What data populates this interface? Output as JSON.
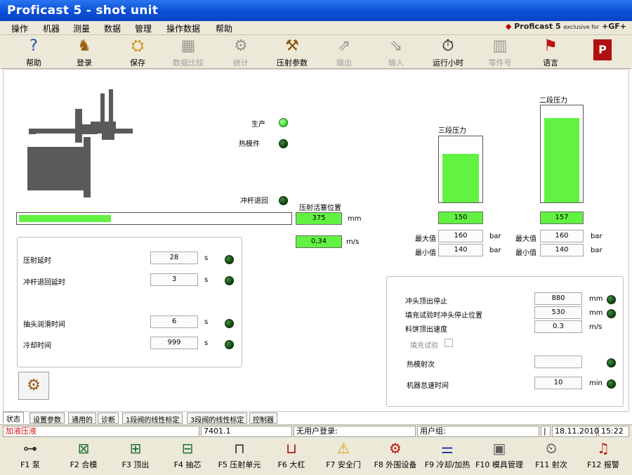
{
  "window": {
    "title": "Proficast 5 - shot unit"
  },
  "menu": {
    "items": [
      "操作",
      "机器",
      "测量",
      "数据",
      "管理",
      "操作数据",
      "帮助"
    ],
    "brand": "Proficast 5",
    "brand_excl": "exclusive for",
    "brand_gf": "+GF+"
  },
  "toolbar": {
    "buttons": [
      {
        "label": "帮助",
        "icon": "help-icon",
        "glyph": "❓",
        "enabled": true
      },
      {
        "label": "登录",
        "icon": "login-icon",
        "glyph": "🐕",
        "enabled": true
      },
      {
        "label": "保存",
        "icon": "save-icon",
        "glyph": "💾",
        "enabled": true
      },
      {
        "label": "数据比较",
        "icon": "compare-icon",
        "glyph": "▦",
        "enabled": false
      },
      {
        "label": "统计",
        "icon": "statistics-icon",
        "glyph": "⚙",
        "enabled": false
      },
      {
        "label": "压射参数",
        "icon": "shot-params-icon",
        "glyph": "🔧",
        "enabled": true
      },
      {
        "label": "输出",
        "icon": "output-icon",
        "glyph": "⇗",
        "enabled": false
      },
      {
        "label": "输入",
        "icon": "input-icon",
        "glyph": "⇘",
        "enabled": false
      },
      {
        "label": "运行小时",
        "icon": "clock-icon",
        "glyph": "⏱",
        "enabled": true
      },
      {
        "label": "零件号",
        "icon": "barcode-icon",
        "glyph": "▥",
        "enabled": false
      },
      {
        "label": "语言",
        "icon": "flags-icon",
        "glyph": "⚑",
        "enabled": true
      },
      {
        "label": "",
        "icon": "pc5-logo-icon",
        "glyph": "P",
        "enabled": true
      }
    ]
  },
  "status_leds": {
    "production": {
      "label": "生产",
      "on": true
    },
    "hot_mold": {
      "label": "热模件",
      "on": false
    },
    "plunger_return": {
      "label": "冲杆退回",
      "on": false
    }
  },
  "piston": {
    "label": "压射活塞位置",
    "position": "375",
    "position_unit": "mm",
    "speed": "0,34",
    "speed_unit": "m/s",
    "progress": 0.34
  },
  "timers": [
    {
      "label": "压射延时",
      "value": "28",
      "unit": "s"
    },
    {
      "label": "冲杆退回延时",
      "value": "3",
      "unit": "s"
    },
    {
      "label": "抽头润滑时间",
      "value": "6",
      "unit": "s"
    },
    {
      "label": "冷却时间",
      "value": "999",
      "unit": "s"
    }
  ],
  "pressure3": {
    "title": "三段压力",
    "value": "150",
    "level": 0.73,
    "max_label": "最大值",
    "max_value": "160",
    "min_label": "最小值",
    "min_value": "140",
    "unit": "bar"
  },
  "pressure2": {
    "title": "二段压力",
    "value": "157",
    "level": 0.87,
    "max_label": "最大值",
    "max_value": "160",
    "min_label": "最小值",
    "min_value": "140",
    "unit": "bar"
  },
  "right_panel": {
    "rows": [
      {
        "label": "冲头顶出停止",
        "value": "880",
        "unit": "mm",
        "led": true
      },
      {
        "label": "填充试验时冲头停止位置",
        "value": "530",
        "unit": "mm",
        "led": true
      },
      {
        "label": "料饼顶出速度",
        "value": "0.3",
        "unit": "m/s",
        "led": false
      }
    ],
    "fill_test_label": "填充试验",
    "hot_mold_shots_label": "热模射次",
    "hot_mold_shots_value": "",
    "idle_label": "机器怠速时间",
    "idle_value": "10",
    "idle_unit": "min"
  },
  "tabs": [
    "状态",
    "设置参数",
    "通用的",
    "诊断",
    "1段阀的线性标定",
    "3段阀的线性标定",
    "控制器"
  ],
  "statusbar": {
    "message": "加液压液",
    "shot_no": "7401.1",
    "user_login": "无用户登录:",
    "user_group": "用户组:",
    "sep": "|",
    "date": "18.11.2010",
    "time": "15:22"
  },
  "fkeys": [
    {
      "label": "F1 泵",
      "icon": "pump-icon",
      "glyph": "⊶"
    },
    {
      "label": "F2 合模",
      "icon": "close-die-icon",
      "glyph": "⊠"
    },
    {
      "label": "F3 顶出",
      "icon": "eject-icon",
      "glyph": "⊞"
    },
    {
      "label": "F4 抽芯",
      "icon": "core-pull-icon",
      "glyph": "⊟"
    },
    {
      "label": "F5 压射单元",
      "icon": "shot-unit-icon",
      "glyph": "⊓"
    },
    {
      "label": "F6 大杠",
      "icon": "tie-bar-icon",
      "glyph": "⊔"
    },
    {
      "label": "F7 安全门",
      "icon": "safety-door-icon",
      "glyph": "⚠"
    },
    {
      "label": "F8 外围设备",
      "icon": "robot-icon",
      "glyph": "⚙"
    },
    {
      "label": "F9 冷却/加热",
      "icon": "cooling-heating-icon",
      "glyph": "⚌"
    },
    {
      "label": "F10 模具管理",
      "icon": "mold-management-icon",
      "glyph": "▣"
    },
    {
      "label": "F11 射次",
      "icon": "shot-counter-icon",
      "glyph": "⏲"
    },
    {
      "label": "F12 报警",
      "icon": "alarm-icon",
      "glyph": "🔔"
    }
  ]
}
